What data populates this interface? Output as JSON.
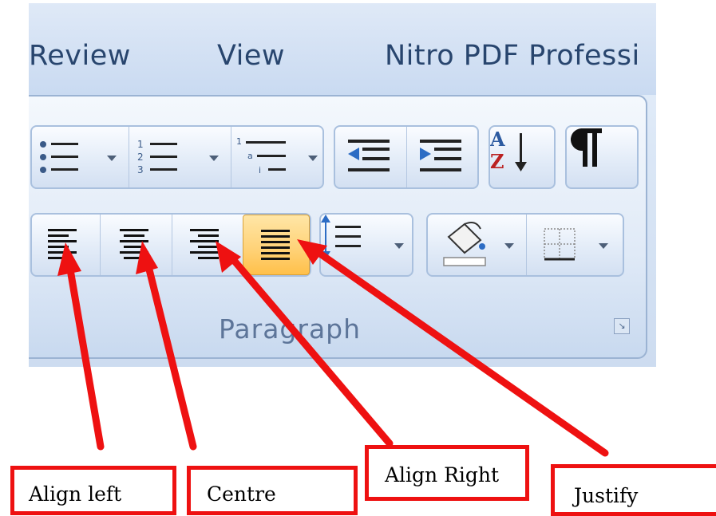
{
  "ribbon": {
    "tabs": [
      "Review",
      "View",
      "Nitro PDF Professi"
    ],
    "group_label": "Paragraph",
    "buttons": {
      "bullets": "bullets-icon",
      "numbering": "numbering-icon",
      "multilevel_list": "multilevel-list-icon",
      "decrease_indent": "decrease-indent-icon",
      "increase_indent": "increase-indent-icon",
      "sort": "sort-az-icon",
      "show_formatting": "pilcrow-icon",
      "align_left": "align-left-icon",
      "centre": "align-center-icon",
      "align_right": "align-right-icon",
      "justify": "justify-icon",
      "line_spacing": "line-spacing-icon",
      "shading": "paint-bucket-icon",
      "borders": "borders-icon"
    },
    "active_button": "justify"
  },
  "annotations": {
    "align_left": "Align left",
    "centre": "Centre",
    "align_right": "Align Right",
    "justify": "Justify"
  },
  "colors": {
    "annotation_red": "#ee1111",
    "active_highlight": "#ffd37a",
    "tab_text": "#28456e",
    "group_label": "#5d7599"
  }
}
